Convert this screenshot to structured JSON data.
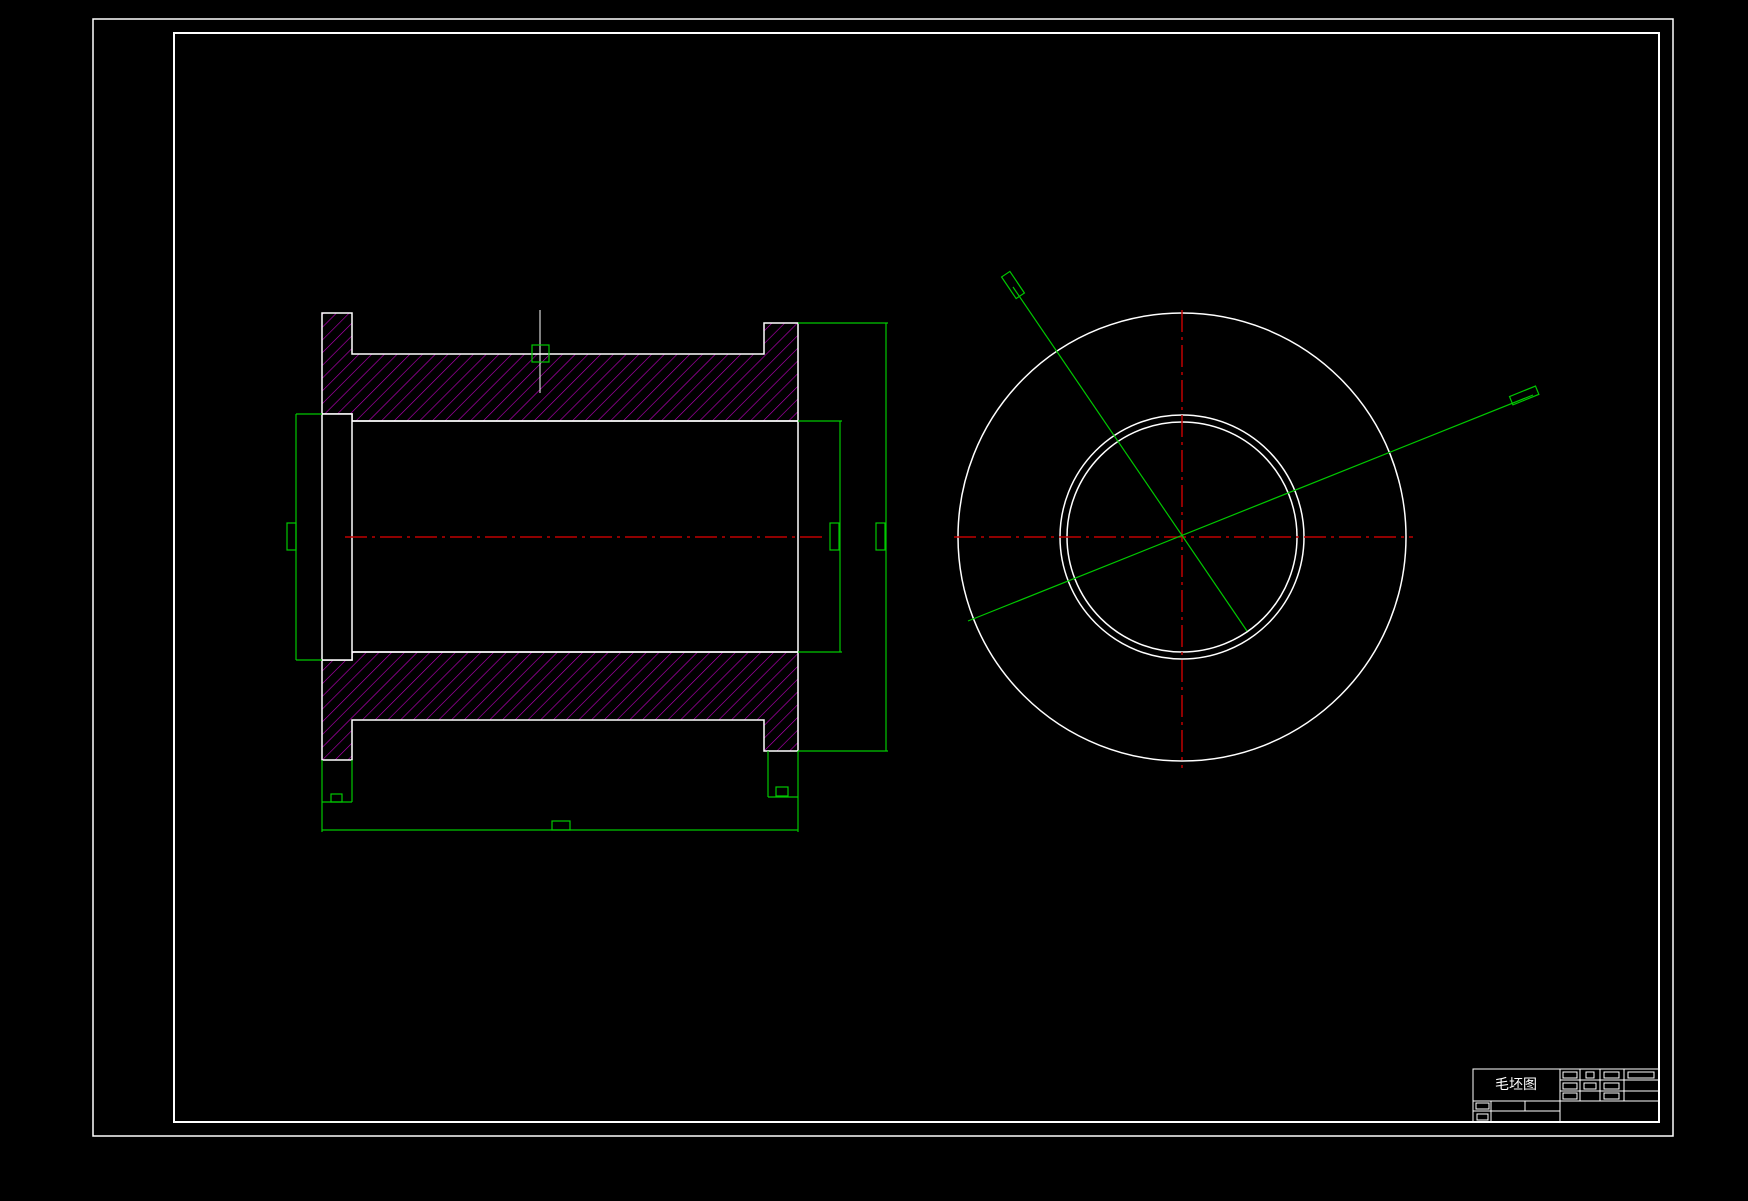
{
  "title_block": {
    "drawing_name": "毛坯图"
  },
  "colors": {
    "background": "#000000",
    "outline": "#ffffff",
    "dimension": "#00c800",
    "centerline": "#c00000",
    "hatch": "#c000c0"
  }
}
